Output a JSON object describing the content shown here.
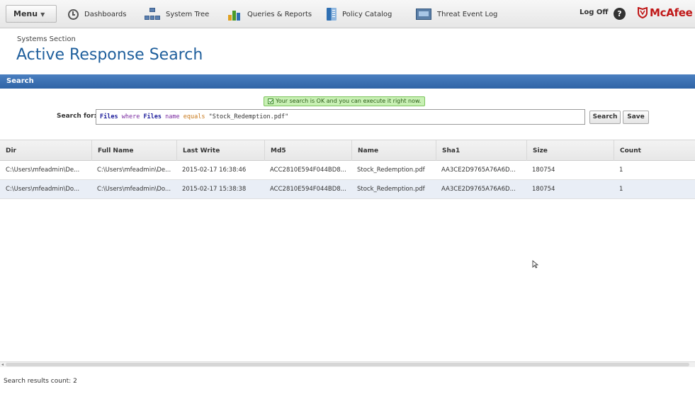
{
  "nav": {
    "menu_label": "Menu",
    "items": [
      {
        "label": "Dashboards",
        "icon": "clock-icon"
      },
      {
        "label": "System Tree",
        "icon": "system-tree-icon"
      },
      {
        "label": "Queries & Reports",
        "icon": "queries-icon"
      },
      {
        "label": "Policy Catalog",
        "icon": "policy-catalog-icon"
      },
      {
        "label": "Threat Event Log",
        "icon": "threat-event-icon"
      }
    ],
    "logoff_label": "Log Off",
    "help_label": "?",
    "brand": "McAfee"
  },
  "header": {
    "section": "Systems Section",
    "title": "Active Response Search"
  },
  "search": {
    "panel_title": "Search",
    "status_message": "Your search is OK and you can execute it right now.",
    "label": "Search for:",
    "query_tokens": {
      "t1": "Files",
      "t2": "where",
      "t3": "Files",
      "t4": "name",
      "t5": "equals",
      "t6": "\"Stock_Redemption.pdf\""
    },
    "search_button": "Search",
    "save_button": "Save"
  },
  "table": {
    "columns": [
      "Dir",
      "Full Name",
      "Last Write",
      "Md5",
      "Name",
      "Sha1",
      "Size",
      "Count"
    ],
    "rows": [
      [
        "C:\\Users\\mfeadmin\\De...",
        "C:\\Users\\mfeadmin\\De...",
        "2015-02-17 16:38:46",
        "ACC2810E594F044BD8...",
        "Stock_Redemption.pdf",
        "AA3CE2D9765A76A6D...",
        "180754",
        "1"
      ],
      [
        "C:\\Users\\mfeadmin\\Do...",
        "C:\\Users\\mfeadmin\\Do...",
        "2015-02-17 15:38:38",
        "ACC2810E594F044BD8...",
        "Stock_Redemption.pdf",
        "AA3CE2D9765A76A6D...",
        "180754",
        "1"
      ]
    ]
  },
  "footer": {
    "result_count": "Search results count: 2"
  },
  "colors": {
    "title_blue": "#1f5f9c",
    "panel_header": "#2f64a6",
    "status_green": "#c8f0b4",
    "brand_red": "#c01818"
  }
}
